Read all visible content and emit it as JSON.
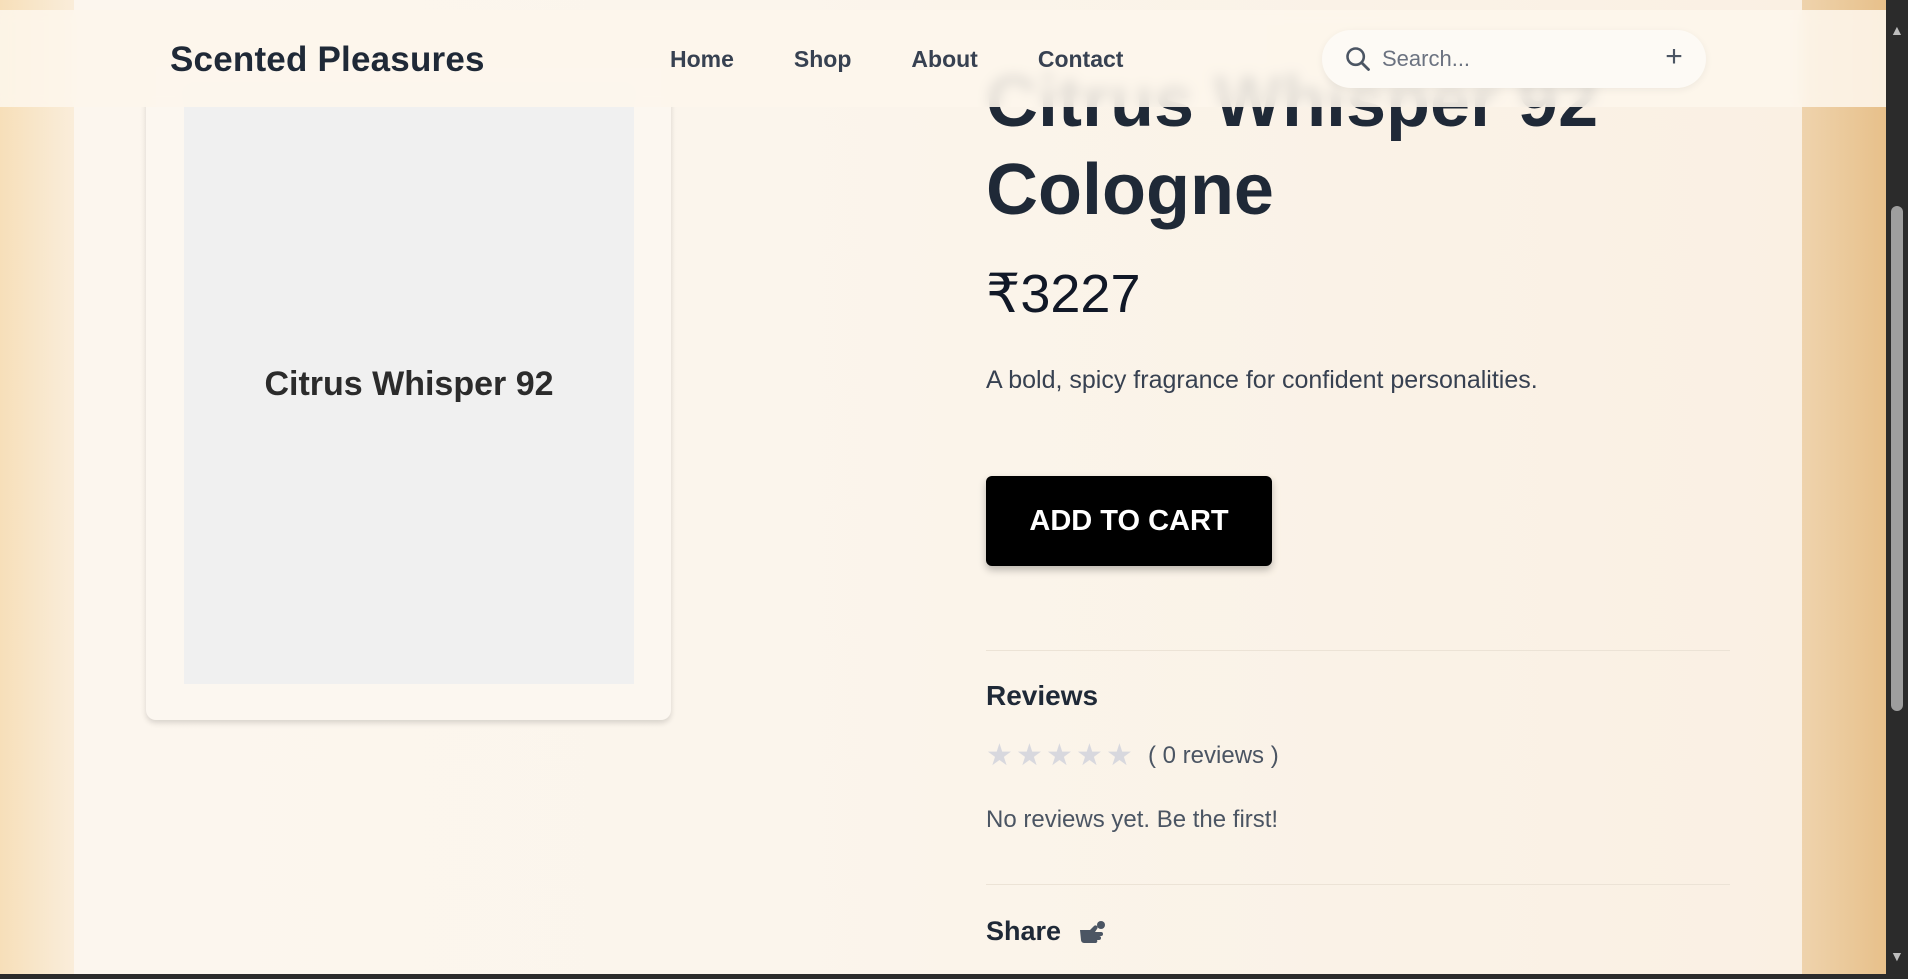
{
  "header": {
    "brand": "Scented Pleasures",
    "nav": [
      "Home",
      "Shop",
      "About",
      "Contact"
    ],
    "search_placeholder": "Search..."
  },
  "product": {
    "image_label": "Citrus Whisper 92",
    "title": "Citrus Whisper 92 Cologne",
    "price": "₹3227",
    "description": "A bold, spicy fragrance for confident personalities.",
    "add_to_cart_label": "ADD TO CART"
  },
  "reviews": {
    "heading": "Reviews",
    "rating": 0,
    "max_rating": 5,
    "count_text": "( 0 reviews )",
    "empty_text": "No reviews yet. Be the first!"
  },
  "share": {
    "label": "Share"
  },
  "icons": {
    "search": "search-icon",
    "plus": "plus-icon",
    "share": "share-icon",
    "star": "star-icon"
  },
  "colors": {
    "brand_text": "#1f2937",
    "button_bg": "#000000",
    "star_empty": "#d8d8de",
    "page_bg": "#fbf5ec"
  }
}
